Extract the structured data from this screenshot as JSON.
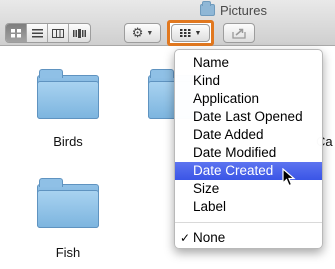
{
  "window": {
    "title": "Pictures"
  },
  "toolbar": {
    "view_modes": [
      "icon-view",
      "list-view",
      "column-view",
      "cover-flow-view"
    ],
    "active_view": "icon-view"
  },
  "folders": [
    {
      "label": "Birds"
    },
    {
      "label": "Fish"
    },
    {
      "label": "Ca"
    }
  ],
  "menu": {
    "items": [
      "Name",
      "Kind",
      "Application",
      "Date Last Opened",
      "Date Added",
      "Date Modified",
      "Date Created",
      "Size",
      "Label"
    ],
    "highlighted": "Date Created",
    "none_item": {
      "check": "✓",
      "label": "None"
    }
  },
  "colors": {
    "highlight": "#3a55e6",
    "callout": "#e1781f",
    "folder": "#7db5df"
  }
}
